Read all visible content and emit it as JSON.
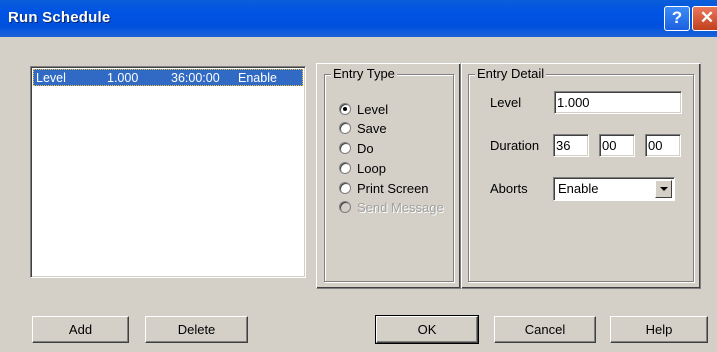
{
  "window": {
    "title": "Run Schedule",
    "help_glyph": "?",
    "close_glyph": "✕"
  },
  "schedule_list": {
    "items": [
      {
        "type": "Level",
        "value": "1.000",
        "duration": "36:00:00",
        "aborts": "Enable"
      }
    ]
  },
  "entry_type": {
    "legend": "Entry Type",
    "options": [
      {
        "label": "Level",
        "selected": true,
        "enabled": true
      },
      {
        "label": "Save",
        "selected": false,
        "enabled": true
      },
      {
        "label": "Do",
        "selected": false,
        "enabled": true
      },
      {
        "label": "Loop",
        "selected": false,
        "enabled": true
      },
      {
        "label": "Print Screen",
        "selected": false,
        "enabled": true
      },
      {
        "label": "Send Message",
        "selected": false,
        "enabled": false
      }
    ]
  },
  "entry_detail": {
    "legend": "Entry Detail",
    "level_label": "Level",
    "level_value": "1.000",
    "duration_label": "Duration",
    "duration_hours": "36",
    "duration_minutes": "00",
    "duration_seconds": "00",
    "aborts_label": "Aborts",
    "aborts_value": "Enable"
  },
  "buttons": {
    "add": "Add",
    "delete": "Delete",
    "ok": "OK",
    "cancel": "Cancel",
    "help": "Help"
  },
  "colors": {
    "title_bar": "#0054e3",
    "selection": "#316ac5",
    "dialog_face": "#d4d0c8"
  }
}
